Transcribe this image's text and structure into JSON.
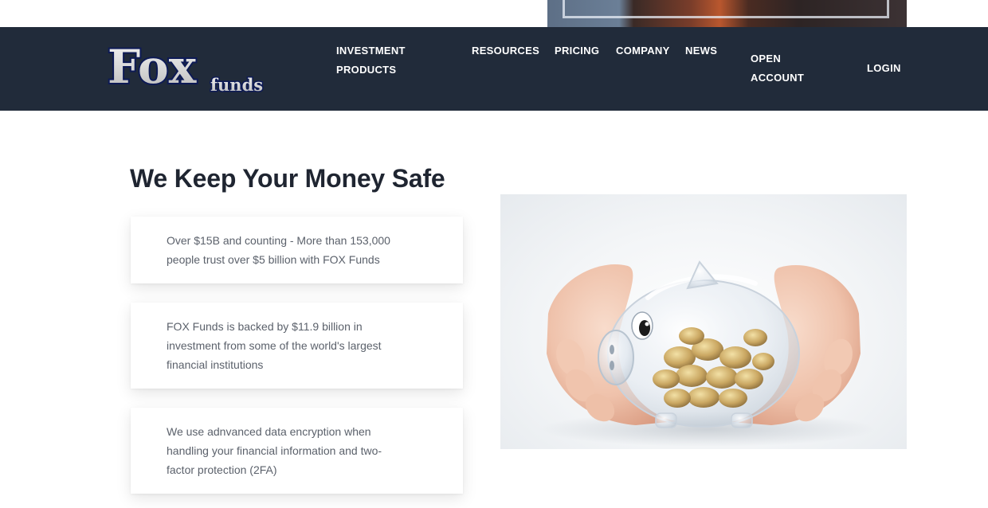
{
  "brand": {
    "logo_main": "Fox",
    "logo_sub": "funds"
  },
  "nav": {
    "investment_products": "INVESTMENT PRODUCTS",
    "resources": "RESOURCES",
    "pricing": "PRICING",
    "company": "COMPANY",
    "news": "NEWS",
    "open_account": "OPEN ACCOUNT",
    "login": "LOGIN"
  },
  "main": {
    "title": "We Keep Your Money Safe",
    "features": [
      {
        "text": "Over $15B and counting - More than 153,000 people trust over $5 billion with FOX Funds"
      },
      {
        "text": "FOX Funds is backed by $11.9 billion in investment from some of the world's largest financial institutions"
      },
      {
        "text": "We use adnvanced data encryption when handling your financial information and two-factor protection (2FA)"
      }
    ]
  },
  "colors": {
    "navbar_bg": "#212b3a",
    "nav_text": "#ffffff",
    "title_text": "#1f2531",
    "body_text": "#5b616b"
  },
  "icons": {
    "logo": "fox-funds-logo",
    "hero_image": "piggy-bank-with-coins-in-hands-photo"
  }
}
